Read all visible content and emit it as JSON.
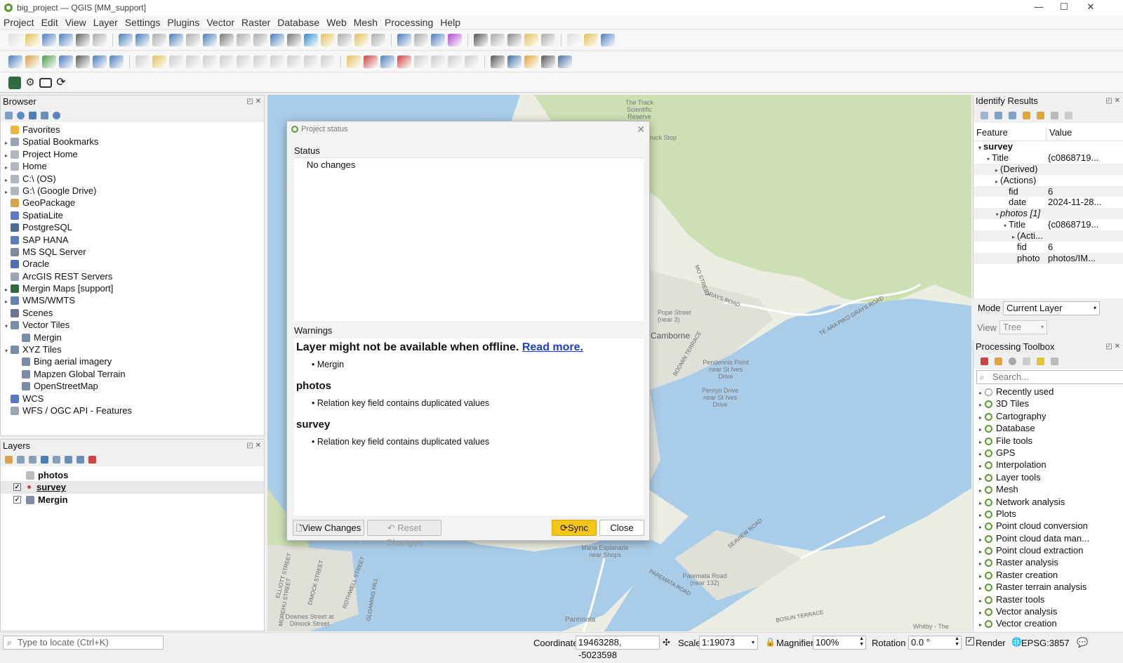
{
  "window": {
    "title": "big_project — QGIS [MM_support]",
    "minimize": "—",
    "maximize": "☐",
    "close": "✕"
  },
  "menu": [
    "Project",
    "Edit",
    "View",
    "Layer",
    "Settings",
    "Plugins",
    "Vector",
    "Raster",
    "Database",
    "Web",
    "Mesh",
    "Processing",
    "Help"
  ],
  "browser": {
    "title": "Browser",
    "items": [
      {
        "label": "Favorites",
        "icon": "star-icon",
        "arrow": "",
        "color": "#e8b73b"
      },
      {
        "label": "Spatial Bookmarks",
        "icon": "bookmark-icon",
        "arrow": "▸",
        "color": "#9aa6b3"
      },
      {
        "label": "Project Home",
        "icon": "folder-icon",
        "arrow": "▸",
        "color": "#b0b7bf"
      },
      {
        "label": "Home",
        "icon": "home-icon",
        "arrow": "▸",
        "color": "#b0b7bf"
      },
      {
        "label": "C:\\ (OS)",
        "icon": "drive-icon",
        "arrow": "▸",
        "color": "#b0b7bf"
      },
      {
        "label": "G:\\ (Google Drive)",
        "icon": "drive-icon",
        "arrow": "▸",
        "color": "#b0b7bf"
      },
      {
        "label": "GeoPackage",
        "icon": "geopackage-icon",
        "arrow": "",
        "color": "#d9a34a"
      },
      {
        "label": "SpatiaLite",
        "icon": "spatialite-icon",
        "arrow": "",
        "color": "#5b79c2"
      },
      {
        "label": "PostgreSQL",
        "icon": "postgresql-icon",
        "arrow": "",
        "color": "#4a6d94"
      },
      {
        "label": "SAP HANA",
        "icon": "sap-hana-icon",
        "arrow": "",
        "color": "#5a7fb5"
      },
      {
        "label": "MS SQL Server",
        "icon": "mssql-icon",
        "arrow": "",
        "color": "#7d8aa0"
      },
      {
        "label": "Oracle",
        "icon": "oracle-icon",
        "arrow": "",
        "color": "#4d71ad"
      },
      {
        "label": "ArcGIS REST Servers",
        "icon": "arcgis-icon",
        "arrow": "",
        "color": "#9aa6b3"
      },
      {
        "label": "Mergin Maps [support]",
        "icon": "mergin-icon",
        "arrow": "▸",
        "color": "#2f6b3f"
      },
      {
        "label": "WMS/WMTS",
        "icon": "wms-icon",
        "arrow": "▸",
        "color": "#6083b5"
      },
      {
        "label": "Scenes",
        "icon": "scenes-icon",
        "arrow": "",
        "color": "#6a7690"
      },
      {
        "label": "Vector Tiles",
        "icon": "vector-tiles-icon",
        "arrow": "▾",
        "color": "#7b8ca5"
      },
      {
        "label": "Mergin",
        "icon": "grid-icon",
        "arrow": "",
        "color": "#7b8ca5",
        "indent": true
      },
      {
        "label": "XYZ Tiles",
        "icon": "xyz-tiles-icon",
        "arrow": "▾",
        "color": "#7b8ca5"
      },
      {
        "label": "Bing aerial imagery",
        "icon": "grid-icon",
        "arrow": "",
        "color": "#7b8ca5",
        "indent": true
      },
      {
        "label": "Mapzen Global Terrain",
        "icon": "grid-icon",
        "arrow": "",
        "color": "#7b8ca5",
        "indent": true
      },
      {
        "label": "OpenStreetMap",
        "icon": "grid-icon",
        "arrow": "",
        "color": "#7b8ca5",
        "indent": true
      },
      {
        "label": "WCS",
        "icon": "wcs-icon",
        "arrow": "",
        "color": "#5b79c2"
      },
      {
        "label": "WFS / OGC API - Features",
        "icon": "wfs-icon",
        "arrow": "",
        "color": "#9aa6b3"
      }
    ]
  },
  "layers": {
    "title": "Layers",
    "items": [
      {
        "label": "photos",
        "checked": "",
        "icon": "table-icon"
      },
      {
        "label": "survey",
        "checked": "✓",
        "icon": "point-icon"
      },
      {
        "label": "Mergin",
        "checked": "✓",
        "icon": "grid-icon"
      }
    ]
  },
  "dialog": {
    "title": "Project status",
    "status_header": "Status",
    "status_text": "No changes",
    "warnings_header": "Warnings",
    "warn1_title": "Layer might not be available when offline.",
    "warn1_link": "Read more.",
    "warn1_item": "Mergin",
    "warn2_title": "photos",
    "warn2_item": "Relation key field contains duplicated values",
    "warn3_title": "survey",
    "warn3_item": "Relation key field contains duplicated values",
    "btn_view": "View Changes",
    "btn_reset": "Reset Changes",
    "btn_sync": "Sync",
    "btn_close": "Close"
  },
  "identify": {
    "title": "Identify Results",
    "col_feature": "Feature",
    "col_value": "Value",
    "rows": [
      {
        "f": "survey",
        "v": "",
        "lvl": 0,
        "arrow": "▾",
        "bold": true
      },
      {
        "f": "Title",
        "v": "{c0868719...",
        "lvl": 1,
        "arrow": "▾"
      },
      {
        "f": "(Derived)",
        "v": "",
        "lvl": 2,
        "arrow": "▸"
      },
      {
        "f": "(Actions)",
        "v": "",
        "lvl": 2,
        "arrow": "▸"
      },
      {
        "f": "fid",
        "v": "6",
        "lvl": 3,
        "arrow": ""
      },
      {
        "f": "date",
        "v": "2024-11-28...",
        "lvl": 3,
        "arrow": ""
      },
      {
        "f": "photos [1]",
        "v": "",
        "lvl": 2,
        "arrow": "▾",
        "italic": true
      },
      {
        "f": "Title",
        "v": "{c0868719...",
        "lvl": 3,
        "arrow": "▾"
      },
      {
        "f": "(Acti...",
        "v": "",
        "lvl": 4,
        "arrow": "▸"
      },
      {
        "f": "fid",
        "v": "6",
        "lvl": 4,
        "arrow": ""
      },
      {
        "f": "photo",
        "v": "photos/IM...",
        "lvl": 4,
        "arrow": ""
      }
    ],
    "mode_label": "Mode",
    "mode_value": "Current Layer",
    "view_label": "View",
    "view_value": "Tree"
  },
  "toolbox": {
    "title": "Processing Toolbox",
    "search_placeholder": "Search...",
    "items": [
      "Recently used",
      "3D Tiles",
      "Cartography",
      "Database",
      "File tools",
      "GPS",
      "Interpolation",
      "Layer tools",
      "Mesh",
      "Network analysis",
      "Plots",
      "Point cloud conversion",
      "Point cloud data man...",
      "Point cloud extraction",
      "Raster analysis",
      "Raster creation",
      "Raster terrain analysis",
      "Raster tools",
      "Vector analysis",
      "Vector creation"
    ]
  },
  "statusbar": {
    "locate_placeholder": "Type to locate (Ctrl+K)",
    "coord_label": "Coordinate",
    "coord_value": "19463288, -5023598",
    "scale_label": "Scale",
    "scale_value": "1:19073",
    "magnifier_label": "Magnifier",
    "magnifier_value": "100%",
    "rotation_label": "Rotation",
    "rotation_value": "0.0 °",
    "render_label": "Render",
    "crs": "EPSG:3857"
  },
  "map": {
    "labels": [
      "The Track Scientific Reserve",
      "ruck Stop",
      "Pope Street (near 3)",
      "Camborne",
      "Pendennis Point near St Ives Drive",
      "Penryn Drive near St Ives Drive",
      "Mana Esplanade near Shops",
      "Paremata Road (near 132)",
      "Downes Street at Dimock Street",
      "Paremata",
      "Whitby - The",
      "GRAYS ROAD",
      "TE ARA PIKO GRAYS ROAD",
      "SEAVIEW ROAD",
      "PAREMATA ROAD",
      "BOSUN TERRACE",
      "MO STREET",
      "BODMIN TERRACE",
      "ELLIOTT STREET",
      "DIMOCK STREET",
      "ROTHWELL STREET",
      "GLOAMING HILL",
      "MOREHU STREET"
    ],
    "colors": {
      "land": "#eceee3",
      "water": "#a9cde9",
      "forest": "#cde0b4",
      "built": "#e0e0d8"
    }
  }
}
